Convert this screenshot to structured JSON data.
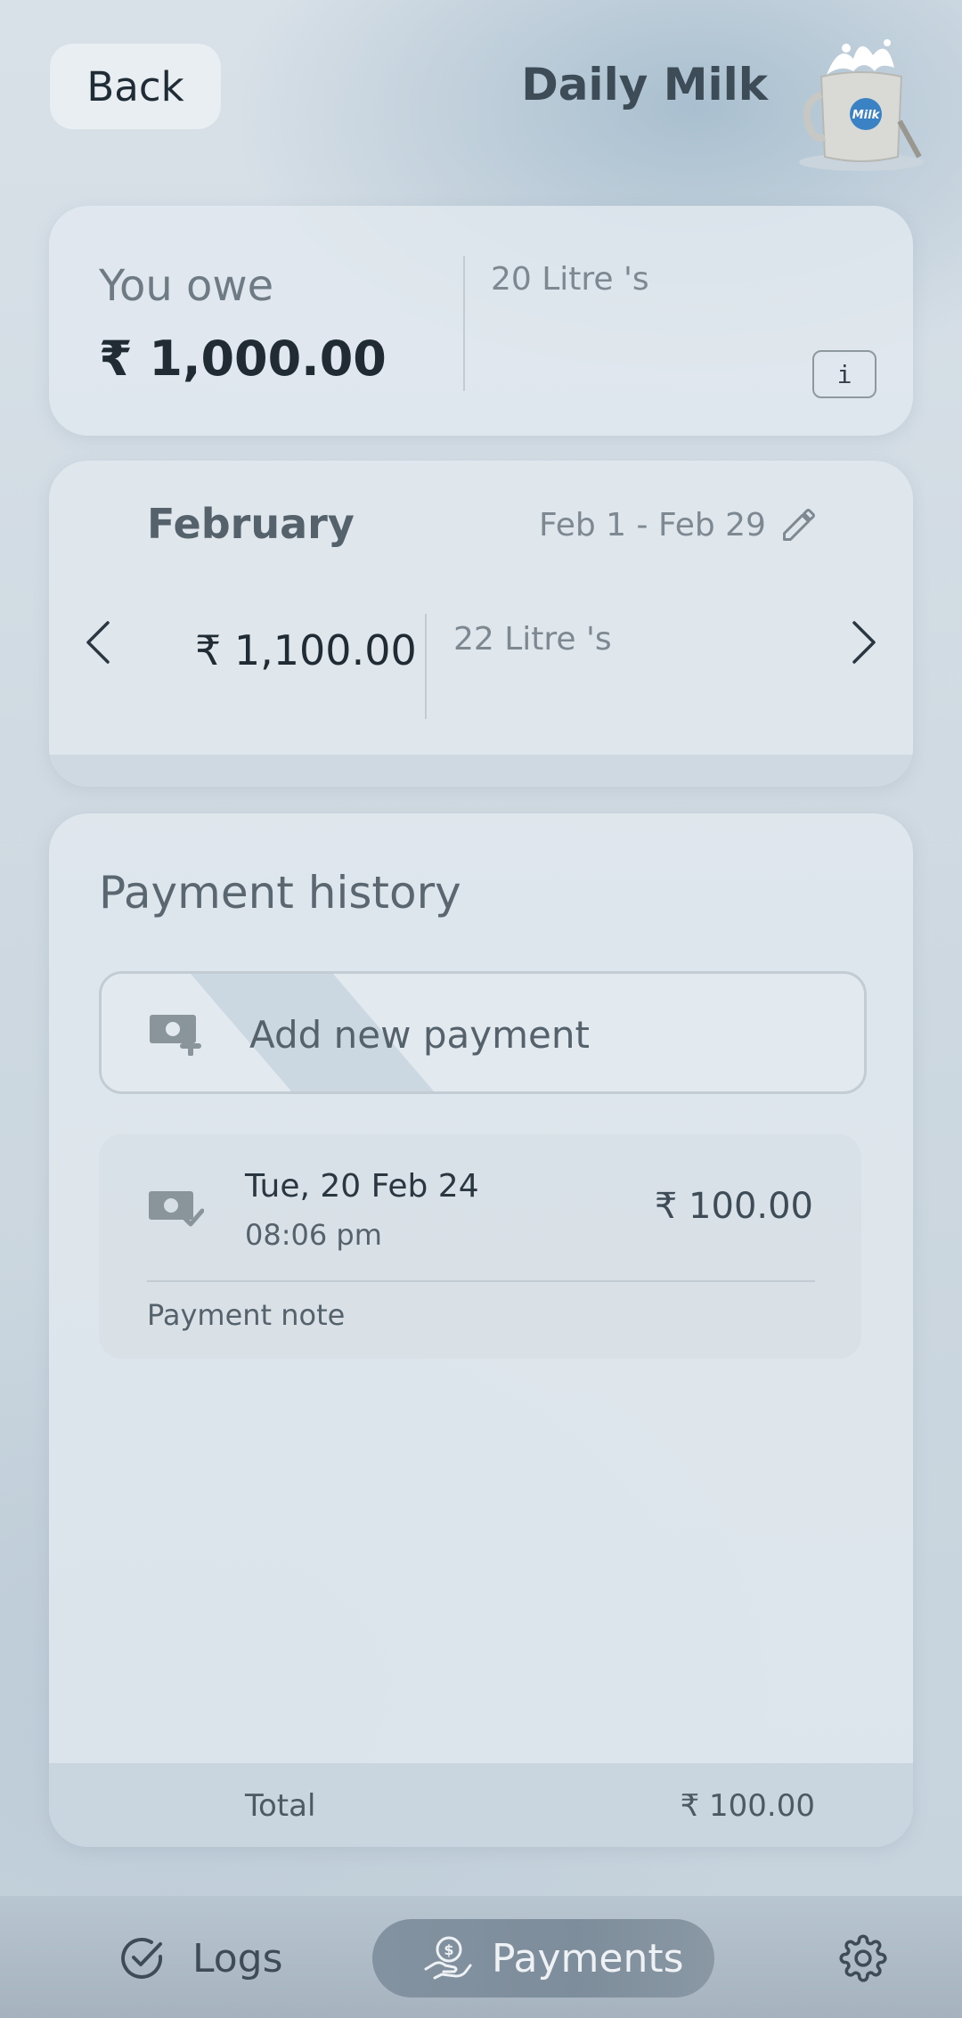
{
  "header": {
    "back_label": "Back",
    "title": "Daily Milk",
    "logo_text": "Milk"
  },
  "owe": {
    "label": "You owe",
    "amount": "₹ 1,000.00",
    "litres": "20 Litre 's",
    "info_label": "i"
  },
  "month": {
    "name": "February",
    "range": "Feb 1 - Feb 29",
    "amount": "₹ 1,100.00",
    "litres": "22 Litre 's"
  },
  "history": {
    "title": "Payment history",
    "add_label": "Add new payment",
    "payments": [
      {
        "date": "Tue, 20 Feb 24",
        "time": "08:06 pm",
        "amount": "₹ 100.00",
        "note": "Payment note"
      }
    ],
    "total_label": "Total",
    "total_amount": "₹ 100.00"
  },
  "nav": {
    "logs_label": "Logs",
    "payments_label": "Payments",
    "active": "payments"
  },
  "colors": {
    "accent": "#3b82c4",
    "active_tab": "#7e8d9b",
    "title_text": "#3e4c57"
  }
}
